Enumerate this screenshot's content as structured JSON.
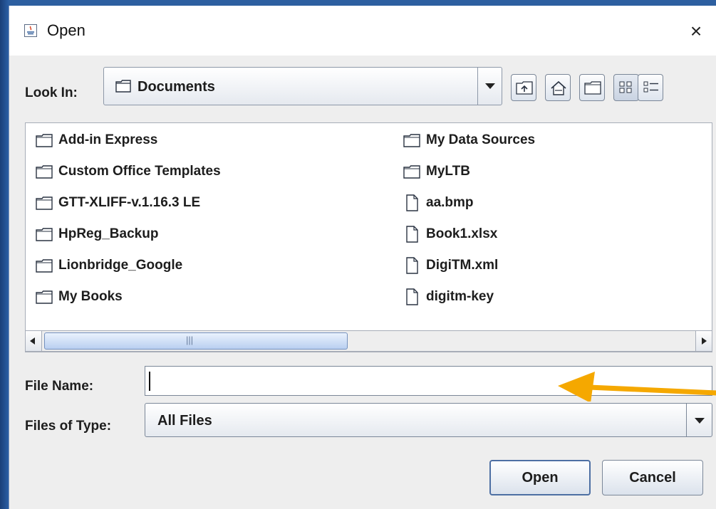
{
  "dialog": {
    "title": "Open",
    "close_glyph": "×"
  },
  "look_in": {
    "label": "Look In:",
    "value": "Documents"
  },
  "toolbar": {
    "buttons": [
      "up-one-level-icon",
      "home-icon",
      "new-folder-icon",
      "list-view-icon",
      "details-view-icon"
    ]
  },
  "files": [
    {
      "name": "Add-in Express",
      "type": "folder"
    },
    {
      "name": "Custom Office Templates",
      "type": "folder"
    },
    {
      "name": "GTT-XLIFF-v.1.16.3 LE",
      "type": "folder"
    },
    {
      "name": "HpReg_Backup",
      "type": "folder"
    },
    {
      "name": "Lionbridge_Google",
      "type": "folder"
    },
    {
      "name": "My Books",
      "type": "folder"
    },
    {
      "name": "My Data Sources",
      "type": "folder"
    },
    {
      "name": "MyLTB",
      "type": "folder"
    },
    {
      "name": "aa.bmp",
      "type": "file"
    },
    {
      "name": "Book1.xlsx",
      "type": "file"
    },
    {
      "name": "DigiTM.xml",
      "type": "file"
    },
    {
      "name": "digitm-key",
      "type": "file"
    }
  ],
  "file_name": {
    "label": "File Name:",
    "value": ""
  },
  "files_of_type": {
    "label": "Files of Type:",
    "value": "All Files"
  },
  "buttons": {
    "open": "Open",
    "cancel": "Cancel"
  },
  "colors": {
    "annotation_arrow": "#f5a800",
    "desktop": "#1c4a86",
    "dialog_bg": "#eeeeee"
  }
}
